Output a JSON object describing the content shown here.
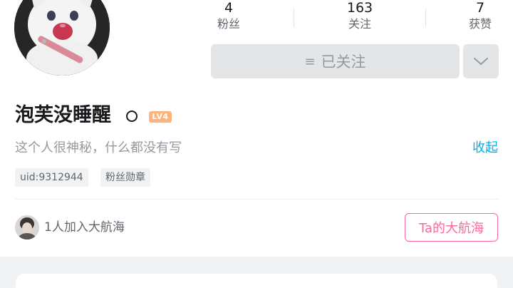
{
  "profile": {
    "name": "泡芙没睡醒",
    "level": "LV4",
    "signature": "这个人很神秘，什么都没有写",
    "collapse_label": "收起"
  },
  "stats": [
    {
      "value": "4",
      "label": "粉丝"
    },
    {
      "value": "163",
      "label": "关注"
    },
    {
      "value": "7",
      "label": "获赞"
    }
  ],
  "follow": {
    "label": "已关注",
    "menu_icon": "≡"
  },
  "tags": {
    "uid": "uid:9312944",
    "fan_badge": "粉丝勋章"
  },
  "guard": {
    "text": "1人加入大航海",
    "button_label": "Ta的大航海"
  },
  "colors": {
    "accent_blue": "#00aeec",
    "accent_pink": "#ff6699",
    "level_orange": "#ffb27a"
  }
}
